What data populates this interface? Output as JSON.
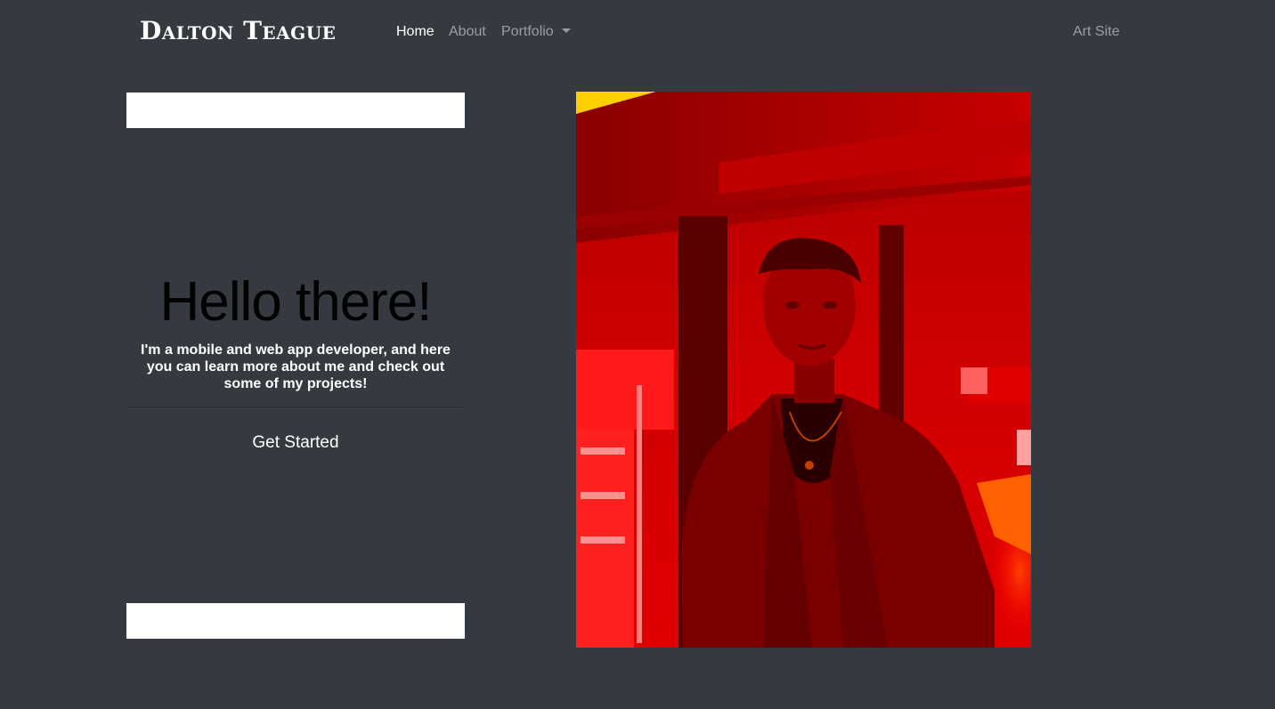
{
  "navbar": {
    "brand": "Dalton Teague",
    "links": {
      "home": "Home",
      "about": "About",
      "portfolio": "Portfolio",
      "art_site": "Art Site"
    }
  },
  "hero": {
    "title": "Hello there!",
    "text": "I'm a mobile and web app developer, and here you can learn more about me and check out some of my projects!",
    "cta": "Get Started"
  },
  "colors": {
    "background": "#343a40",
    "photo_tint": "#ff0000"
  }
}
